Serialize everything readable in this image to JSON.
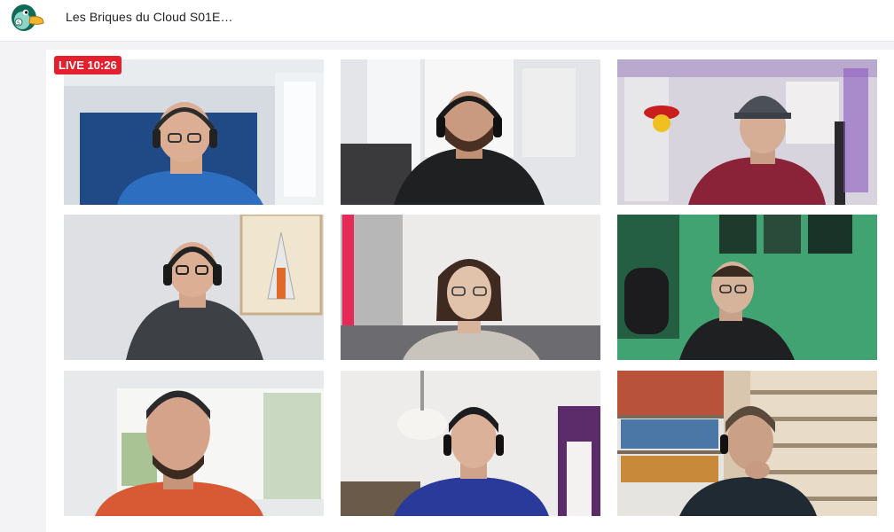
{
  "header": {
    "title": "Les Briques du Cloud S01E…",
    "logo_icon": "duck-mascot-icon"
  },
  "stream": {
    "live_badge": "LIVE 10:26",
    "accent": "#e5202e"
  },
  "participants": [
    {
      "tile": 1,
      "background": "blue-room",
      "headset": true
    },
    {
      "tile": 2,
      "background": "white-room",
      "headset": true
    },
    {
      "tile": 3,
      "background": "purple-lit-room",
      "headset": false
    },
    {
      "tile": 4,
      "background": "poster-wall",
      "headset": true
    },
    {
      "tile": 5,
      "background": "pink-stripe-wall",
      "headset": false
    },
    {
      "tile": 6,
      "background": "green-lit-room",
      "headset": false
    },
    {
      "tile": 7,
      "background": "window",
      "headset": false
    },
    {
      "tile": 8,
      "background": "living-room",
      "headset": true
    },
    {
      "tile": 9,
      "background": "bookshelf-wood-wall",
      "headset": true
    }
  ]
}
